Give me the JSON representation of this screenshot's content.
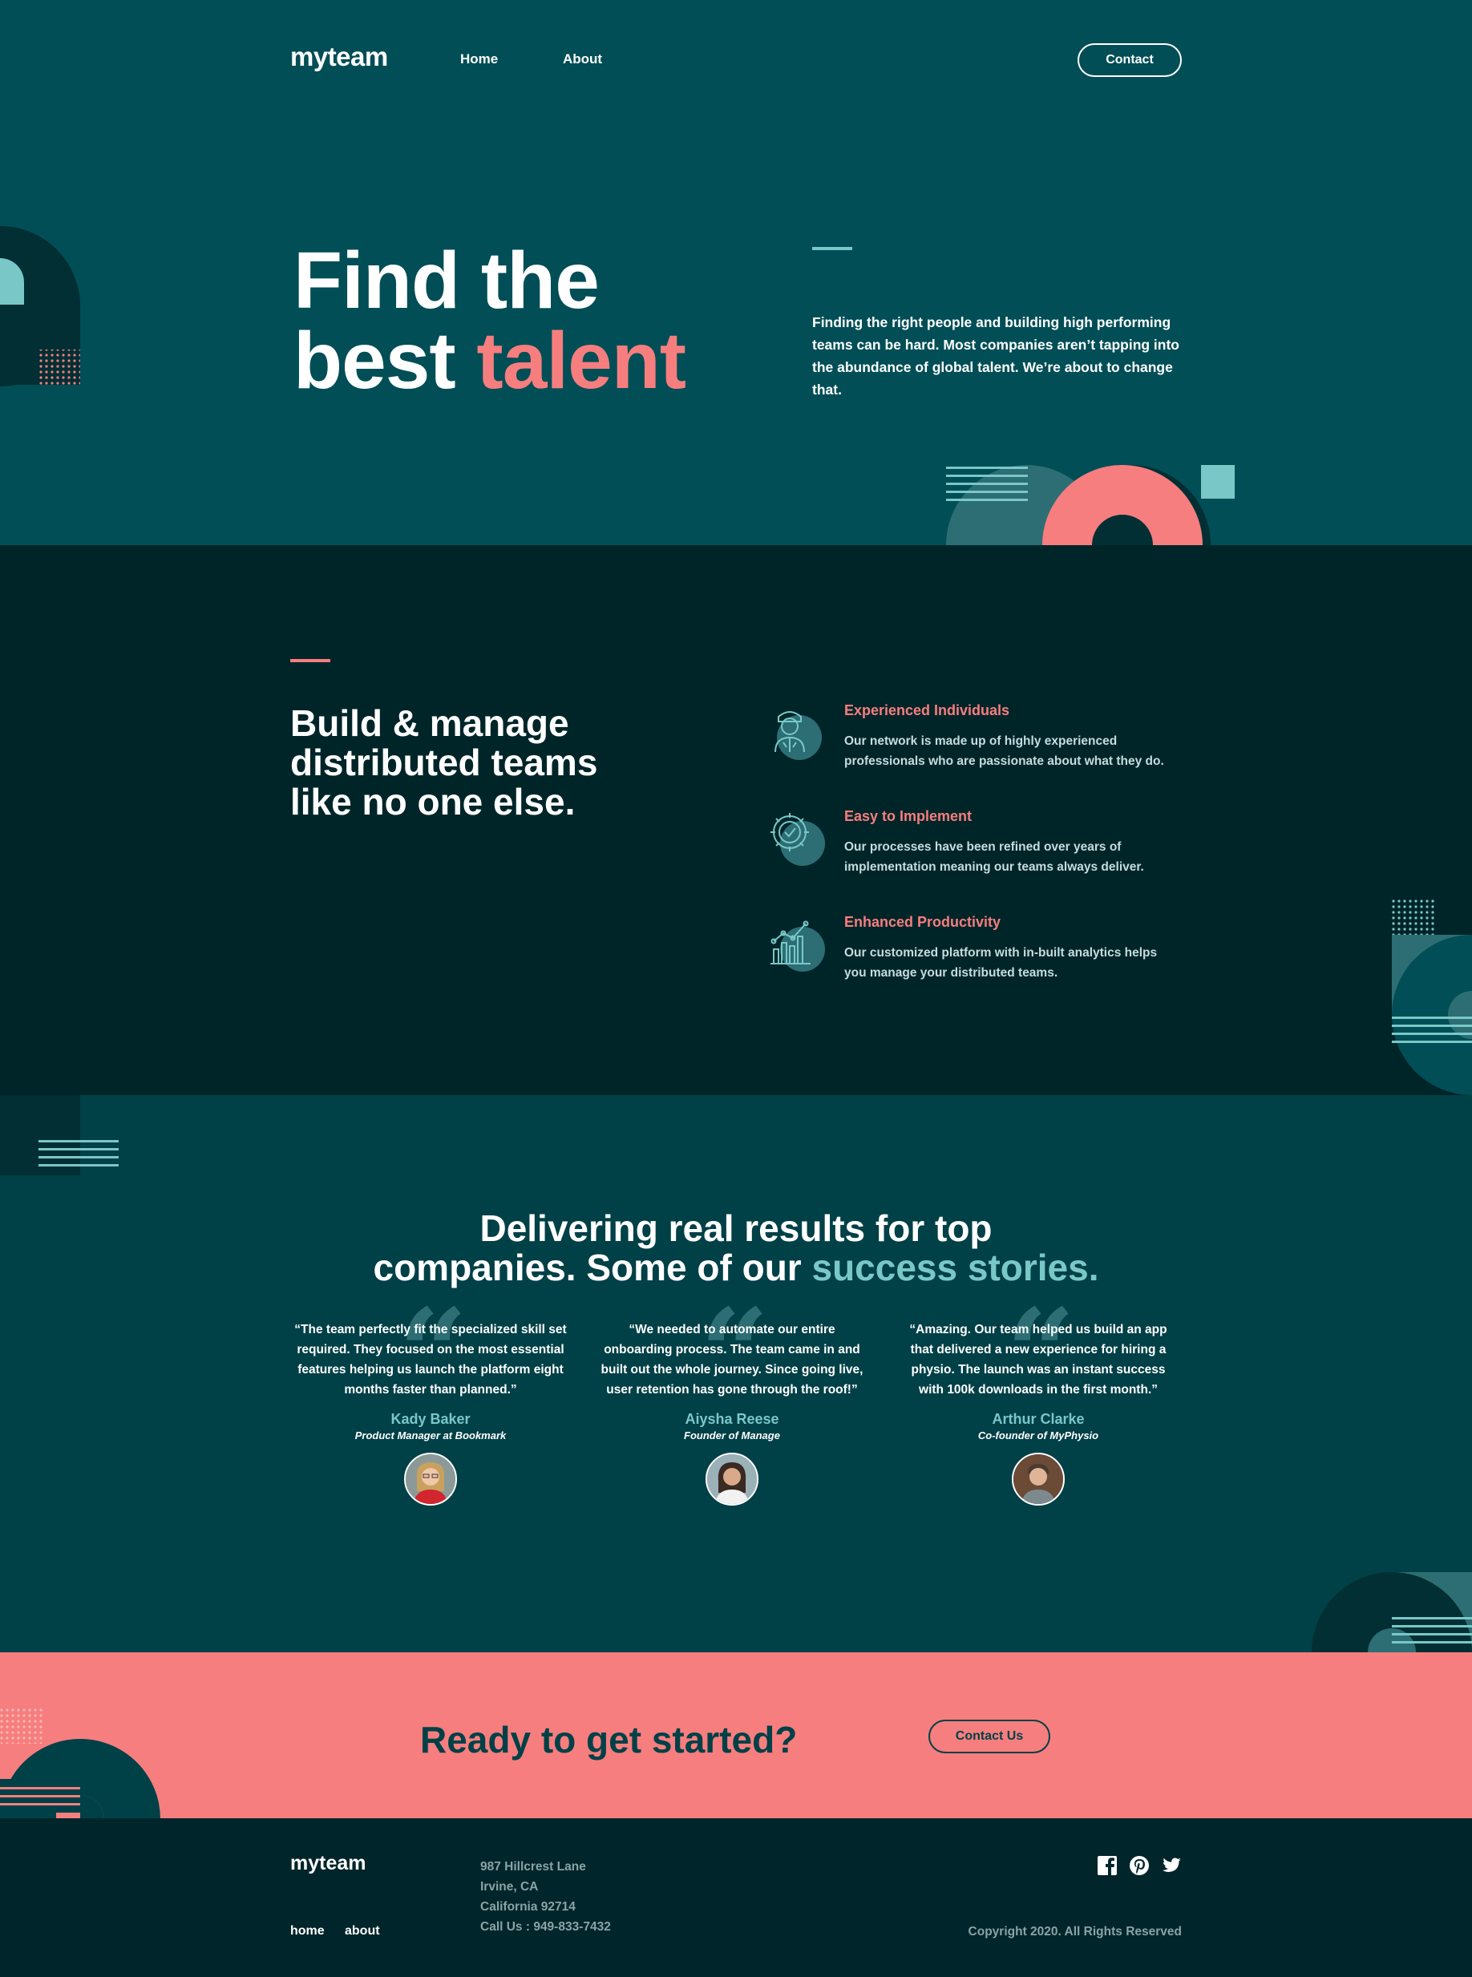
{
  "header": {
    "logo": "myteam",
    "nav": [
      {
        "label": "Home"
      },
      {
        "label": "About"
      }
    ],
    "contact_label": "Contact"
  },
  "hero": {
    "title_line1": "Find the",
    "title_line2_plain": "best ",
    "title_line2_accent": "talent",
    "description": "Finding the right people and building high performing teams can be hard. Most companies aren’t tapping into the abundance of global talent. We’re about to change that."
  },
  "features": {
    "title": "Build & manage distributed teams like no one else.",
    "items": [
      {
        "icon": "person-icon",
        "title": "Experienced Individuals",
        "text": "Our network is made up of highly experienced professionals who are passionate about what they do."
      },
      {
        "icon": "gear-check-icon",
        "title": "Easy to Implement",
        "text": "Our processes have been refined over years of implementation meaning our teams always deliver."
      },
      {
        "icon": "chart-growth-icon",
        "title": "Enhanced Productivity",
        "text": "Our customized platform with in-built analytics helps you manage your distributed teams."
      }
    ]
  },
  "testimonials": {
    "title_line1": "Delivering real results for top",
    "title_line2_plain": "companies. Some of our ",
    "title_line2_accent": "success stories.",
    "items": [
      {
        "quote": "“The team perfectly fit the specialized skill set required. They focused on the most essential features helping us launch the platform eight months faster than planned.”",
        "name": "Kady Baker",
        "role": "Product Manager at Bookmark"
      },
      {
        "quote": "“We needed to automate our entire onboarding process. The team came in and built out the whole journey. Since going live, user retention has gone through the roof!”",
        "name": "Aiysha Reese",
        "role": "Founder of Manage"
      },
      {
        "quote": "“Amazing. Our team helped us build an app that delivered a new experience for hiring a physio. The launch was an instant success with 100k downloads in the first month.”",
        "name": "Arthur Clarke",
        "role": "Co-founder of MyPhysio"
      }
    ]
  },
  "cta": {
    "title": "Ready to get started?",
    "button_label": "Contact Us"
  },
  "footer": {
    "logo": "myteam",
    "links": [
      {
        "label": "home"
      },
      {
        "label": "about"
      }
    ],
    "address": [
      "987 Hillcrest Lane",
      "Irvine, CA",
      "California 92714",
      "Call Us : 949-833-7432"
    ],
    "socials": [
      "facebook-icon",
      "pinterest-icon",
      "twitter-icon"
    ],
    "copyright": "Copyright 2020. All Rights Reserved"
  },
  "colors": {
    "hero_bg": "#014e56",
    "features_bg": "#002529",
    "testimonials_bg": "#004047",
    "cta_bg": "#f67e7e",
    "footer_bg": "#00252a",
    "accent_coral": "#f67e7e",
    "accent_teal": "#79c8c7"
  }
}
